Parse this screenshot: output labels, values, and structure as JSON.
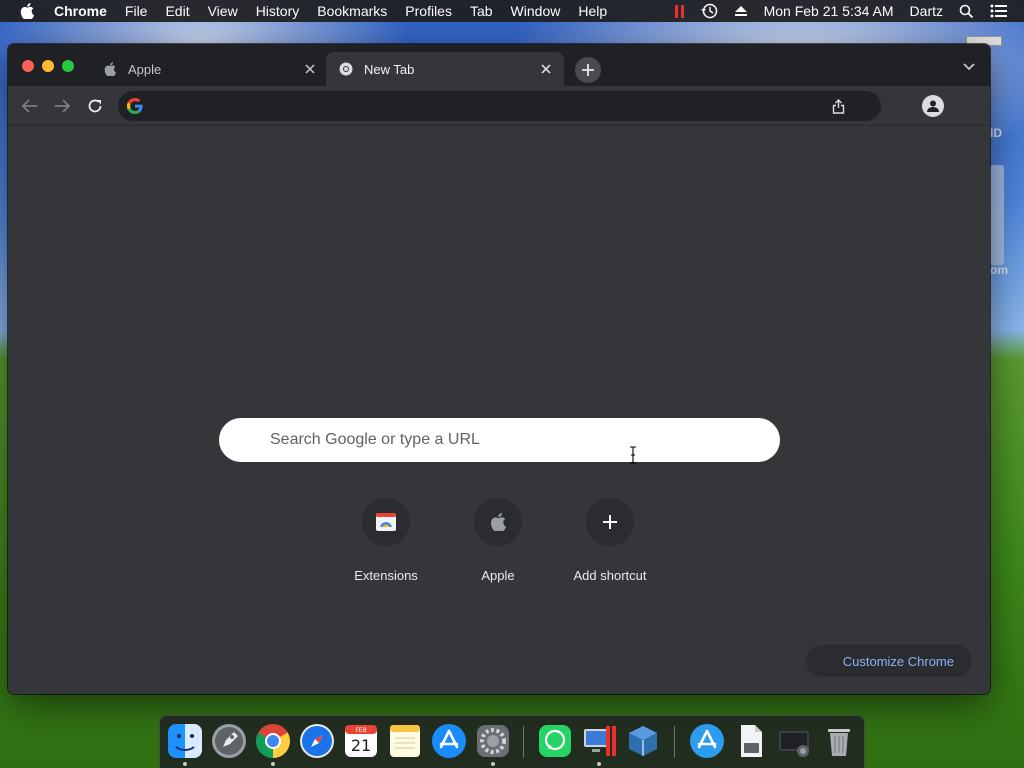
{
  "menubar": {
    "app_name": "Chrome",
    "items": [
      "File",
      "Edit",
      "View",
      "History",
      "Bookmarks",
      "Profiles",
      "Tab",
      "Window",
      "Help"
    ],
    "datetime": "Mon Feb 21  5:34 AM",
    "user": "Dartz"
  },
  "desktop": {
    "peek_labels": [
      "ID",
      "om"
    ]
  },
  "browser": {
    "tabs": [
      {
        "title": "Apple",
        "active": false
      },
      {
        "title": "New Tab",
        "active": true
      }
    ],
    "omnibox": {
      "value": "",
      "placeholder": ""
    }
  },
  "ntp": {
    "search_placeholder": "Search Google or type a URL",
    "shortcuts": [
      {
        "label": "Extensions",
        "icon": "extensions-icon"
      },
      {
        "label": "Apple",
        "icon": "apple-icon"
      },
      {
        "label": "Add shortcut",
        "icon": "plus-icon"
      }
    ],
    "customize_label": "Customize Chrome"
  },
  "dock": {
    "items": [
      {
        "name": "finder-icon",
        "running": true
      },
      {
        "name": "launchpad-icon",
        "running": false
      },
      {
        "name": "chrome-icon",
        "running": true
      },
      {
        "name": "safari-icon",
        "running": false
      },
      {
        "name": "calendar-icon",
        "running": false,
        "month": "FEB",
        "day": "21"
      },
      {
        "name": "notes-icon",
        "running": false
      },
      {
        "name": "app-store-icon",
        "running": false
      },
      {
        "name": "system-preferences-icon",
        "running": true
      },
      {
        "name": "whatsapp-icon",
        "running": false
      },
      {
        "name": "parallels-icon",
        "running": true
      },
      {
        "name": "virtualbox-icon",
        "running": false
      },
      {
        "name": "app-store-folder-icon",
        "running": false
      },
      {
        "name": "document-folder-icon",
        "running": false
      },
      {
        "name": "screenshot-folder-icon",
        "running": false
      },
      {
        "name": "trash-icon",
        "running": false
      }
    ]
  },
  "colors": {
    "window_bg": "#35363a",
    "tabstrip_bg": "#202124",
    "link_blue": "#8ab4f8",
    "search_bg": "#ffffff"
  }
}
